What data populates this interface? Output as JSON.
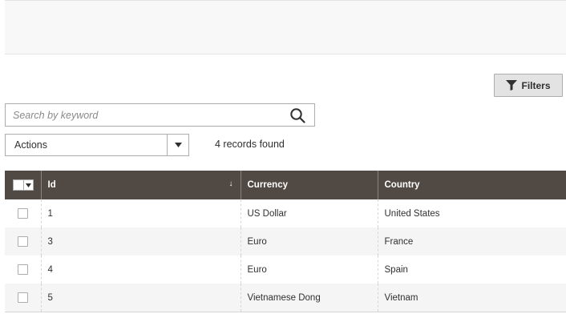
{
  "toolbar": {
    "filters_label": "Filters",
    "search_placeholder": "Search by keyword",
    "search_value": "",
    "actions_label": "Actions",
    "records_found": "4 records found"
  },
  "grid": {
    "columns": [
      "Id",
      "Currency",
      "Country"
    ],
    "sort_indicator": "↓",
    "rows": [
      {
        "id": "1",
        "currency": "US Dollar",
        "country": "United States"
      },
      {
        "id": "3",
        "currency": "Euro",
        "country": "France"
      },
      {
        "id": "4",
        "currency": "Euro",
        "country": "Spain"
      },
      {
        "id": "5",
        "currency": "Vietnamese Dong",
        "country": "Vietnam"
      }
    ]
  },
  "colors": {
    "header_bg": "#514943",
    "header_text": "#ffffff",
    "stripe": "#f5f5f5",
    "button_bg": "#e3e3e3",
    "border": "#adadad"
  },
  "icons": {
    "filters": "funnel-icon",
    "search": "magnifier-icon",
    "dropdown": "caret-down-icon"
  }
}
